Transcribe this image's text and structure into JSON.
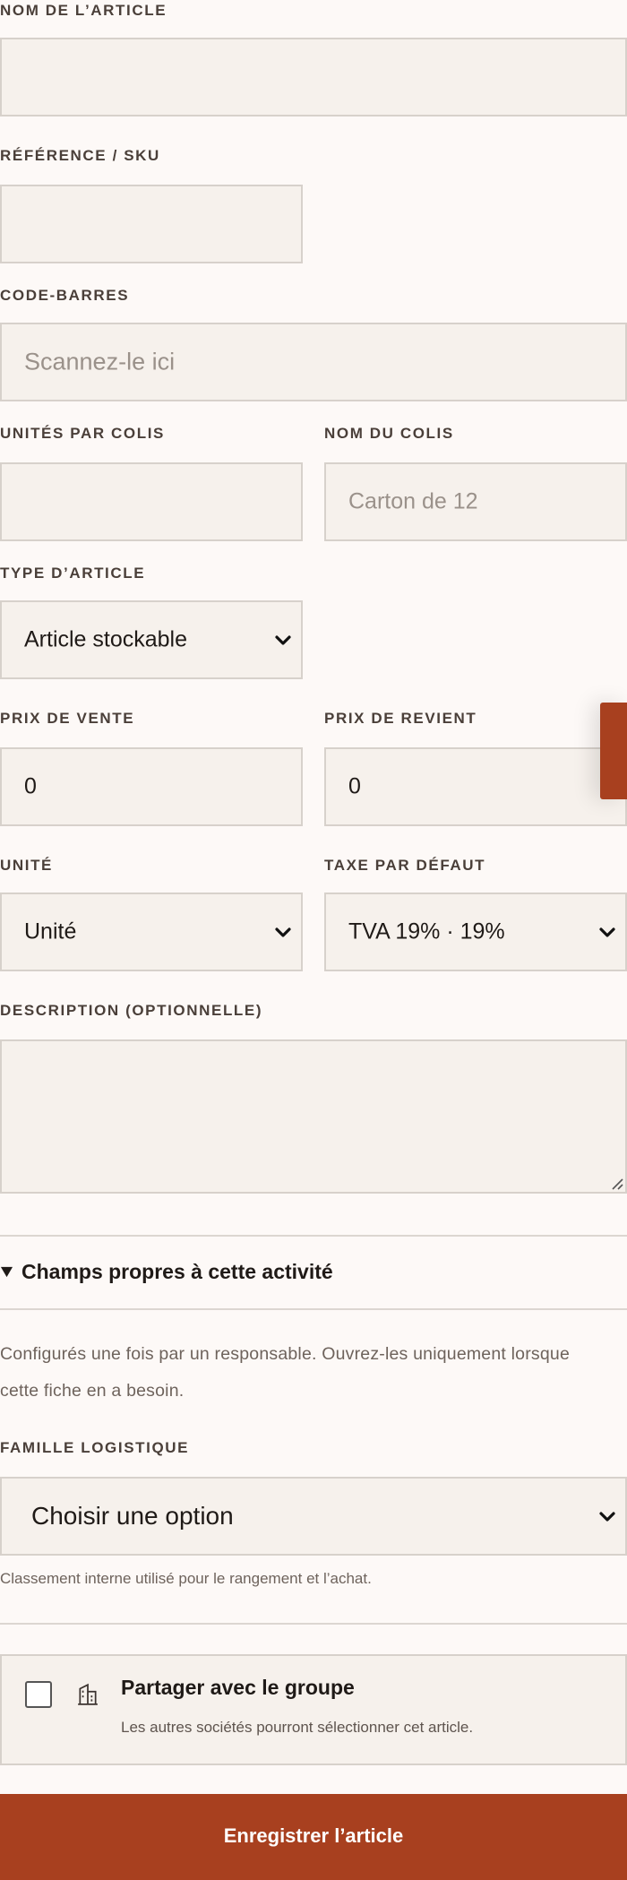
{
  "form": {
    "name_label": "NOM DE L’ARTICLE",
    "name_value": "",
    "ref_label": "RÉFÉRENCE / SKU",
    "ref_value": "",
    "barcode_label": "CODE-BARRES",
    "barcode_placeholder": "Scannez-le ici",
    "units_per_pack_label": "UNITÉS PAR COLIS",
    "units_per_pack_value": "",
    "pack_name_label": "NOM DU COLIS",
    "pack_name_placeholder": "Carton de 12",
    "type_label": "TYPE D’ARTICLE",
    "type_value": "Article stockable",
    "sale_price_label": "PRIX DE VENTE",
    "sale_price_value": "0",
    "cost_price_label": "PRIX DE REVIENT",
    "cost_price_value": "0",
    "unit_label": "UNITÉ",
    "unit_value": "Unité",
    "tax_label": "TAXE PAR DÉFAUT",
    "tax_value": "TVA 19% · 19%",
    "description_label": "DESCRIPTION (OPTIONNELLE)",
    "description_value": ""
  },
  "custom": {
    "summary": "Champs propres à cette activité",
    "intro_line1": "Configurés une fois par un responsable. Ouvrez-les uniquement lorsque",
    "intro_line2": "cette fiche en a besoin.",
    "family_label": "FAMILLE LOGISTIQUE",
    "family_value": "Choisir une option",
    "family_help": "Classement interne utilisé pour le rangement et l’achat."
  },
  "share": {
    "title": "Partager avec le groupe",
    "subtitle": "Les autres sociétés pourront sélectionner cet article.",
    "checked": false,
    "icon": "building-icon"
  },
  "submit_label": "Enregistrer l’article",
  "colors": {
    "accent": "#a8401f",
    "page_bg": "#fdf9f7",
    "field_bg": "#f6f1ec",
    "field_border": "#d7d1cb"
  }
}
